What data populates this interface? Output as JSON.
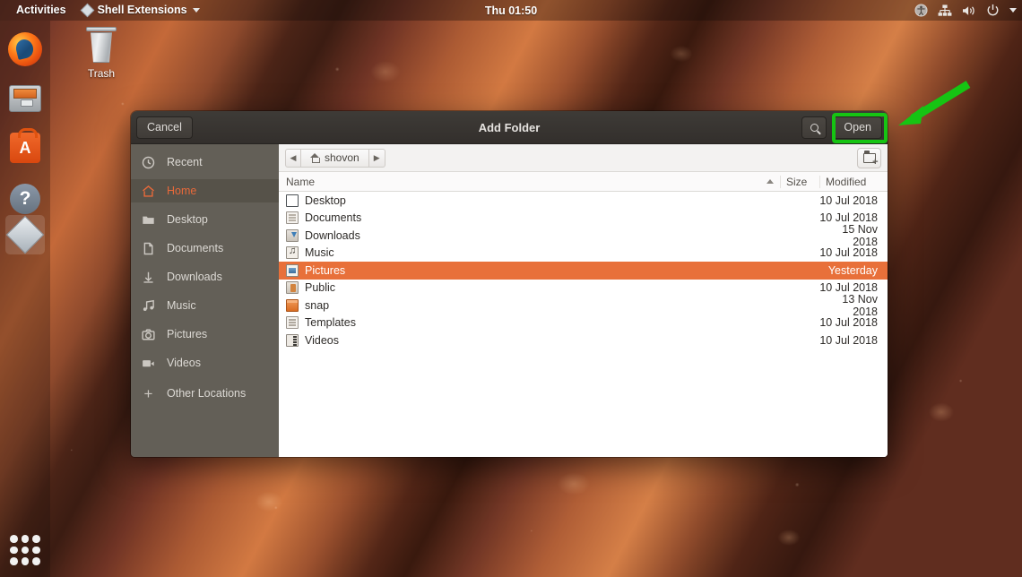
{
  "topbar": {
    "activities_label": "Activities",
    "app_menu_label": "Shell Extensions",
    "app_menu_icon": "diamond-icon",
    "clock": "Thu 01:50",
    "indicators": [
      "accessibility-icon",
      "network-icon",
      "volume-icon",
      "power-icon",
      "chevron-down-icon"
    ]
  },
  "dock": {
    "items": [
      {
        "name": "firefox",
        "label": "Firefox Web Browser",
        "running": false
      },
      {
        "name": "file-archiver",
        "label": "Files",
        "running": false
      },
      {
        "name": "ubuntu-software",
        "label": "Ubuntu Software",
        "running": false
      },
      {
        "name": "help",
        "label": "Help",
        "running": false
      },
      {
        "name": "shell-extensions",
        "label": "Shell Extensions",
        "running": true
      }
    ],
    "show_applications_label": "Show Applications"
  },
  "desktop": {
    "trash_label": "Trash"
  },
  "dialog": {
    "title": "Add Folder",
    "cancel_label": "Cancel",
    "open_label": "Open",
    "search_icon": "search-icon",
    "new_folder_icon": "new-folder-icon",
    "pathbar": {
      "back_glyph": "◀",
      "forward_glyph": "▶",
      "crumbs": [
        {
          "label": "shovon",
          "icon": "home-icon",
          "active": true
        }
      ]
    },
    "sidebar": {
      "items": [
        {
          "label": "Recent",
          "icon": "clock-icon",
          "active": false
        },
        {
          "label": "Home",
          "icon": "home-icon",
          "active": true
        },
        {
          "label": "Desktop",
          "icon": "folder-icon",
          "active": false
        },
        {
          "label": "Documents",
          "icon": "document-icon",
          "active": false
        },
        {
          "label": "Downloads",
          "icon": "download-icon",
          "active": false
        },
        {
          "label": "Music",
          "icon": "music-icon",
          "active": false
        },
        {
          "label": "Pictures",
          "icon": "camera-icon",
          "active": false
        },
        {
          "label": "Videos",
          "icon": "video-icon",
          "active": false
        },
        {
          "label": "Other Locations",
          "icon": "plus-icon",
          "active": false
        }
      ]
    },
    "columns": {
      "name": "Name",
      "size": "Size",
      "modified": "Modified",
      "sort": "ascending"
    },
    "files": [
      {
        "name": "Desktop",
        "size": "",
        "modified": "10 Jul 2018",
        "icon": "desktop-folder-icon",
        "selected": false
      },
      {
        "name": "Documents",
        "size": "",
        "modified": "10 Jul 2018",
        "icon": "documents-folder-icon",
        "selected": false
      },
      {
        "name": "Downloads",
        "size": "",
        "modified": "15 Nov 2018",
        "icon": "downloads-folder-icon",
        "selected": false
      },
      {
        "name": "Music",
        "size": "",
        "modified": "10 Jul 2018",
        "icon": "music-folder-icon",
        "selected": false
      },
      {
        "name": "Pictures",
        "size": "",
        "modified": "Yesterday",
        "icon": "pictures-folder-icon",
        "selected": true
      },
      {
        "name": "Public",
        "size": "",
        "modified": "10 Jul 2018",
        "icon": "public-folder-icon",
        "selected": false
      },
      {
        "name": "snap",
        "size": "",
        "modified": "13 Nov 2018",
        "icon": "snap-folder-icon",
        "selected": false
      },
      {
        "name": "Templates",
        "size": "",
        "modified": "10 Jul 2018",
        "icon": "templates-folder-icon",
        "selected": false
      },
      {
        "name": "Videos",
        "size": "",
        "modified": "10 Jul 2018",
        "icon": "videos-folder-icon",
        "selected": false
      }
    ]
  },
  "annotations": {
    "highlight_color": "#16c413",
    "highlight_target": "Open",
    "arrow": "points-to-open-button"
  },
  "colors": {
    "ubuntu_orange": "#e8703a",
    "selection": "#e8703a",
    "headerbar": "#3e3b37",
    "sidebar": "#635f57",
    "annotation_green": "#16c413"
  }
}
